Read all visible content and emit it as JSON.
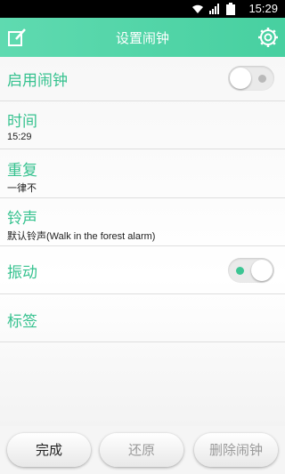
{
  "status": {
    "time": "15:29"
  },
  "header": {
    "title": "设置闹钟",
    "left_icon": "edit-icon",
    "right_icon": "gear-icon"
  },
  "rows": {
    "enable": {
      "label": "启用闹钟",
      "toggle_on": false
    },
    "time": {
      "label": "时间",
      "value": "15:29"
    },
    "repeat": {
      "label": "重复",
      "value": "一律不"
    },
    "ringtone": {
      "label": "铃声",
      "value": "默认铃声(Walk in the forest alarm)"
    },
    "vibrate": {
      "label": "振动",
      "toggle_on": true
    },
    "tag": {
      "label": "标签"
    }
  },
  "buttons": {
    "done": "完成",
    "revert": "还原",
    "delete": "删除闹钟"
  },
  "colors": {
    "accent": "#3cc593",
    "header": "#52d6a6"
  }
}
